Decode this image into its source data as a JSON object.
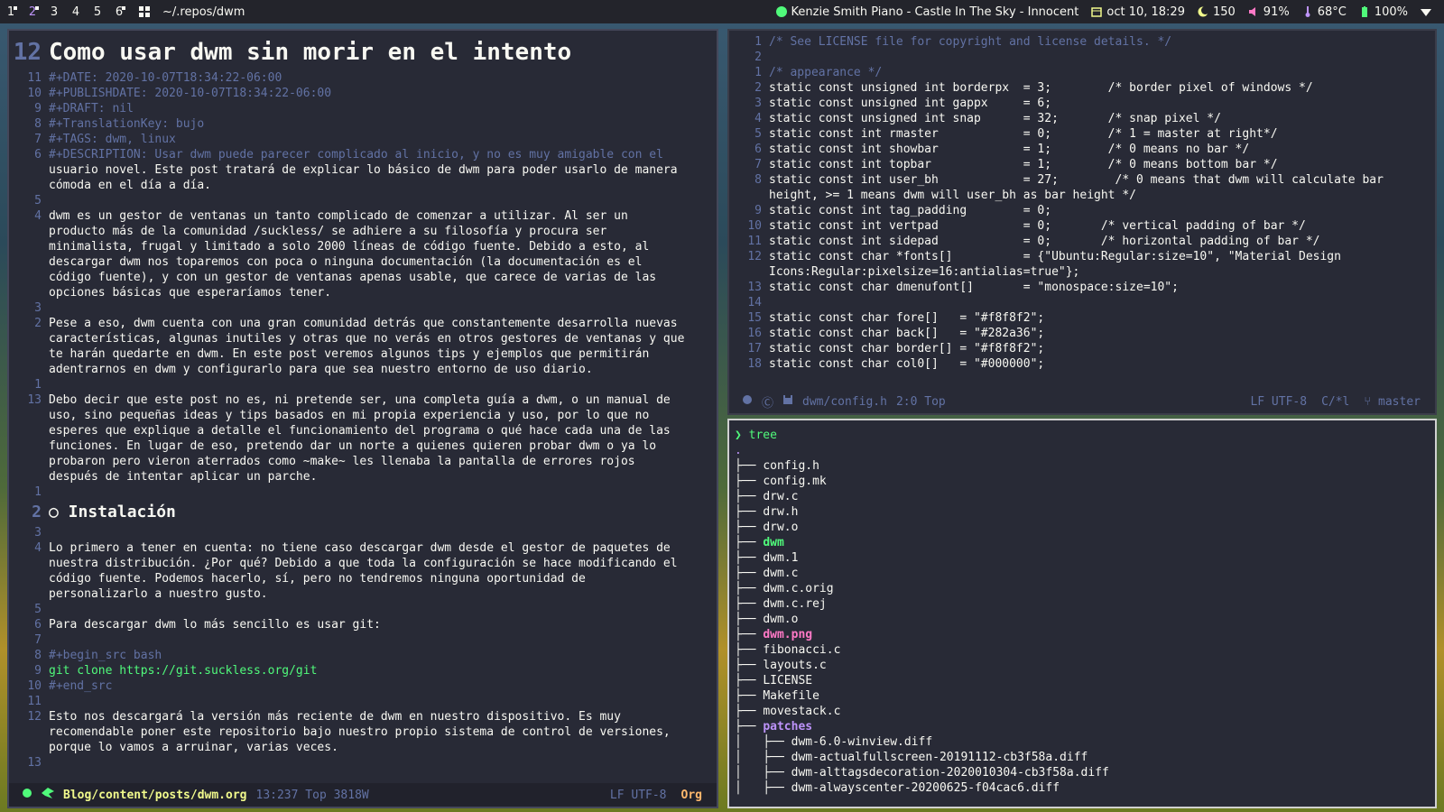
{
  "topbar": {
    "tags": [
      "1",
      "2",
      "3",
      "4",
      "5",
      "6"
    ],
    "current_tag": "2",
    "path": "~/.repos/dwm",
    "music": "Kenzie Smith Piano - Castle In The Sky - Innocent",
    "date": "oct 10, 18:29",
    "brightness": "150",
    "volume": "91%",
    "temp": "68°C",
    "battery": "100%"
  },
  "left": {
    "title": "Como usar dwm sin morir en el intento",
    "title_ln": "12",
    "lines": [
      {
        "n": "11",
        "text": "#+DATE: 2020-10-07T18:34:22-06:00"
      },
      {
        "n": "10",
        "text": "#+PUBLISHDATE: 2020-10-07T18:34:22-06:00"
      },
      {
        "n": "9",
        "text": "#+DRAFT: nil"
      },
      {
        "n": "8",
        "text": "#+TranslationKey: bujo"
      },
      {
        "n": "7",
        "text": "#+TAGS: dwm, linux"
      },
      {
        "n": "6",
        "text": "#+DESCRIPTION: Usar dwm puede parecer complicado al inicio, y no es muy amigable con el"
      },
      {
        "n": "",
        "text": "usuario novel. Este post tratará de explicar lo básico de dwm para poder usarlo de manera"
      },
      {
        "n": "",
        "text": "cómoda en el día a día."
      },
      {
        "n": "5",
        "text": ""
      },
      {
        "n": "4",
        "text": "dwm es un gestor de ventanas un tanto complicado de comenzar a utilizar. Al ser un"
      },
      {
        "n": "",
        "text": "producto más de la comunidad /suckless/ se adhiere a su filosofía y procura ser"
      },
      {
        "n": "",
        "text": "minimalista, frugal y limitado a solo 2000 líneas de código fuente. Debido a esto, al"
      },
      {
        "n": "",
        "text": "descargar dwm nos toparemos con poca o ninguna documentación (la documentación es el"
      },
      {
        "n": "",
        "text": "código fuente), y con un gestor de ventanas apenas usable, que carece de varias de las"
      },
      {
        "n": "",
        "text": "opciones básicas que esperaríamos tener."
      },
      {
        "n": "3",
        "text": ""
      },
      {
        "n": "2",
        "text": "Pese a eso, dwm cuenta con una gran comunidad detrás que constantemente desarrolla nuevas"
      },
      {
        "n": "",
        "text": "características, algunas inutiles y otras que no verás en otros gestores de ventanas y que"
      },
      {
        "n": "",
        "text": "te harán quedarte en dwm. En este post veremos algunos tips y ejemplos que permitirán"
      },
      {
        "n": "",
        "text": "adentrarnos en dwm y configurarlo para que sea nuestro entorno de uso diario."
      },
      {
        "n": "1",
        "text": ""
      },
      {
        "n": "13",
        "text": "Debo decir que este post no es, ni pretende ser, una completa guía a dwm, o un manual de"
      },
      {
        "n": "",
        "text": "uso, sino pequeñas ideas y tips basados en mi propia experiencia y uso, por lo que no"
      },
      {
        "n": "",
        "text": "esperes que explique a detalle el funcionamiento del programa o qué hace cada una de las"
      },
      {
        "n": "",
        "text": "funciones. En lugar de eso, pretendo dar un norte a quienes quieren probar dwm o ya lo"
      },
      {
        "n": "",
        "text": "probaron pero vieron aterrados como ~make~ les llenaba la pantalla de errores rojos"
      },
      {
        "n": "",
        "text": "después de intentar aplicar un parche."
      },
      {
        "n": "1",
        "text": ""
      }
    ],
    "h2": "○ Instalación",
    "h2_ln": "2",
    "lines2": [
      {
        "n": "3",
        "text": ""
      },
      {
        "n": "4",
        "text": "Lo primero a tener en cuenta: no tiene caso descargar dwm desde el gestor de paquetes de"
      },
      {
        "n": "",
        "text": "nuestra distribución. ¿Por qué? Debido a que toda la configuración se hace modificando el"
      },
      {
        "n": "",
        "text": "código fuente. Podemos hacerlo, sí, pero no tendremos ninguna oportunidad de"
      },
      {
        "n": "",
        "text": "personalizarlo a nuestro gusto."
      },
      {
        "n": "5",
        "text": ""
      },
      {
        "n": "6",
        "text": "Para descargar dwm lo más sencillo es usar git:"
      },
      {
        "n": "7",
        "text": ""
      },
      {
        "n": "8",
        "text": "#+begin_src bash"
      },
      {
        "n": "9",
        "text": "git clone https://git.suckless.org/git"
      },
      {
        "n": "10",
        "text": "#+end_src"
      },
      {
        "n": "11",
        "text": ""
      },
      {
        "n": "12",
        "text": "Esto nos descargará la versión más reciente de dwm en nuestro dispositivo. Es muy"
      },
      {
        "n": "",
        "text": "recomendable poner este repositorio bajo nuestro propio sistema de control de versiones,"
      },
      {
        "n": "",
        "text": "porque lo vamos a arruinar, varias veces."
      },
      {
        "n": "13",
        "text": ""
      }
    ],
    "modeline": {
      "file": "Blog/content/posts/dwm.org",
      "pos": "13:237 Top 3818W",
      "enc": "LF UTF-8",
      "mode": "Org"
    }
  },
  "right": {
    "lines": [
      {
        "n": "1",
        "text": "/* See LICENSE file for copyright and license details. */"
      },
      {
        "n": "2",
        "text": ""
      },
      {
        "n": "1",
        "text": "/* appearance */"
      },
      {
        "n": "2",
        "text": "static const unsigned int borderpx  = 3;        /* border pixel of windows */"
      },
      {
        "n": "3",
        "text": "static const unsigned int gappx     = 6;"
      },
      {
        "n": "4",
        "text": "static const unsigned int snap      = 32;       /* snap pixel */"
      },
      {
        "n": "5",
        "text": "static const int rmaster            = 0;        /* 1 = master at right*/"
      },
      {
        "n": "6",
        "text": "static const int showbar            = 1;        /* 0 means no bar */"
      },
      {
        "n": "7",
        "text": "static const int topbar             = 1;        /* 0 means bottom bar */"
      },
      {
        "n": "8",
        "text": "static const int user_bh            = 27;        /* 0 means that dwm will calculate bar"
      },
      {
        "n": "",
        "text": "height, >= 1 means dwm will user_bh as bar height */"
      },
      {
        "n": "9",
        "text": "static const int tag_padding        = 0;"
      },
      {
        "n": "10",
        "text": "static const int vertpad            = 0;       /* vertical padding of bar */"
      },
      {
        "n": "11",
        "text": "static const int sidepad            = 0;       /* horizontal padding of bar */"
      },
      {
        "n": "12",
        "text": "static const char *fonts[]          = {\"Ubuntu:Regular:size=10\", \"Material Design"
      },
      {
        "n": "",
        "text": "Icons:Regular:pixelsize=16:antialias=true\"};"
      },
      {
        "n": "13",
        "text": "static const char dmenufont[]       = \"monospace:size=10\";"
      },
      {
        "n": "14",
        "text": ""
      },
      {
        "n": "15",
        "text": "static const char fore[]   = \"#f8f8f2\";"
      },
      {
        "n": "16",
        "text": "static const char back[]   = \"#282a36\";"
      },
      {
        "n": "17",
        "text": "static const char border[] = \"#f8f8f2\";"
      },
      {
        "n": "18",
        "text": "static const char col0[]   = \"#000000\";"
      }
    ],
    "modeline": {
      "file": "dwm/config.h",
      "pos": "2:0 Top",
      "enc": "LF UTF-8",
      "mode": "C/*l",
      "branch": "master"
    }
  },
  "term": {
    "prompt": "❯ tree",
    "dot": ".",
    "entries": [
      {
        "prefix": "├── ",
        "name": "config.h",
        "style": ""
      },
      {
        "prefix": "├── ",
        "name": "config.mk",
        "style": ""
      },
      {
        "prefix": "├── ",
        "name": "drw.c",
        "style": ""
      },
      {
        "prefix": "├── ",
        "name": "drw.h",
        "style": ""
      },
      {
        "prefix": "├── ",
        "name": "drw.o",
        "style": ""
      },
      {
        "prefix": "├── ",
        "name": "dwm",
        "style": "green"
      },
      {
        "prefix": "├── ",
        "name": "dwm.1",
        "style": ""
      },
      {
        "prefix": "├── ",
        "name": "dwm.c",
        "style": ""
      },
      {
        "prefix": "├── ",
        "name": "dwm.c.orig",
        "style": ""
      },
      {
        "prefix": "├── ",
        "name": "dwm.c.rej",
        "style": ""
      },
      {
        "prefix": "├── ",
        "name": "dwm.o",
        "style": ""
      },
      {
        "prefix": "├── ",
        "name": "dwm.png",
        "style": "pink"
      },
      {
        "prefix": "├── ",
        "name": "fibonacci.c",
        "style": ""
      },
      {
        "prefix": "├── ",
        "name": "layouts.c",
        "style": ""
      },
      {
        "prefix": "├── ",
        "name": "LICENSE",
        "style": ""
      },
      {
        "prefix": "├── ",
        "name": "Makefile",
        "style": ""
      },
      {
        "prefix": "├── ",
        "name": "movestack.c",
        "style": ""
      },
      {
        "prefix": "├── ",
        "name": "patches",
        "style": "blue"
      },
      {
        "prefix": "│   ├── ",
        "name": "dwm-6.0-winview.diff",
        "style": ""
      },
      {
        "prefix": "│   ├── ",
        "name": "dwm-actualfullscreen-20191112-cb3f58a.diff",
        "style": ""
      },
      {
        "prefix": "│   ├── ",
        "name": "dwm-alttagsdecoration-2020010304-cb3f58a.diff",
        "style": ""
      },
      {
        "prefix": "│   ├── ",
        "name": "dwm-alwayscenter-20200625-f04cac6.diff",
        "style": ""
      }
    ]
  }
}
